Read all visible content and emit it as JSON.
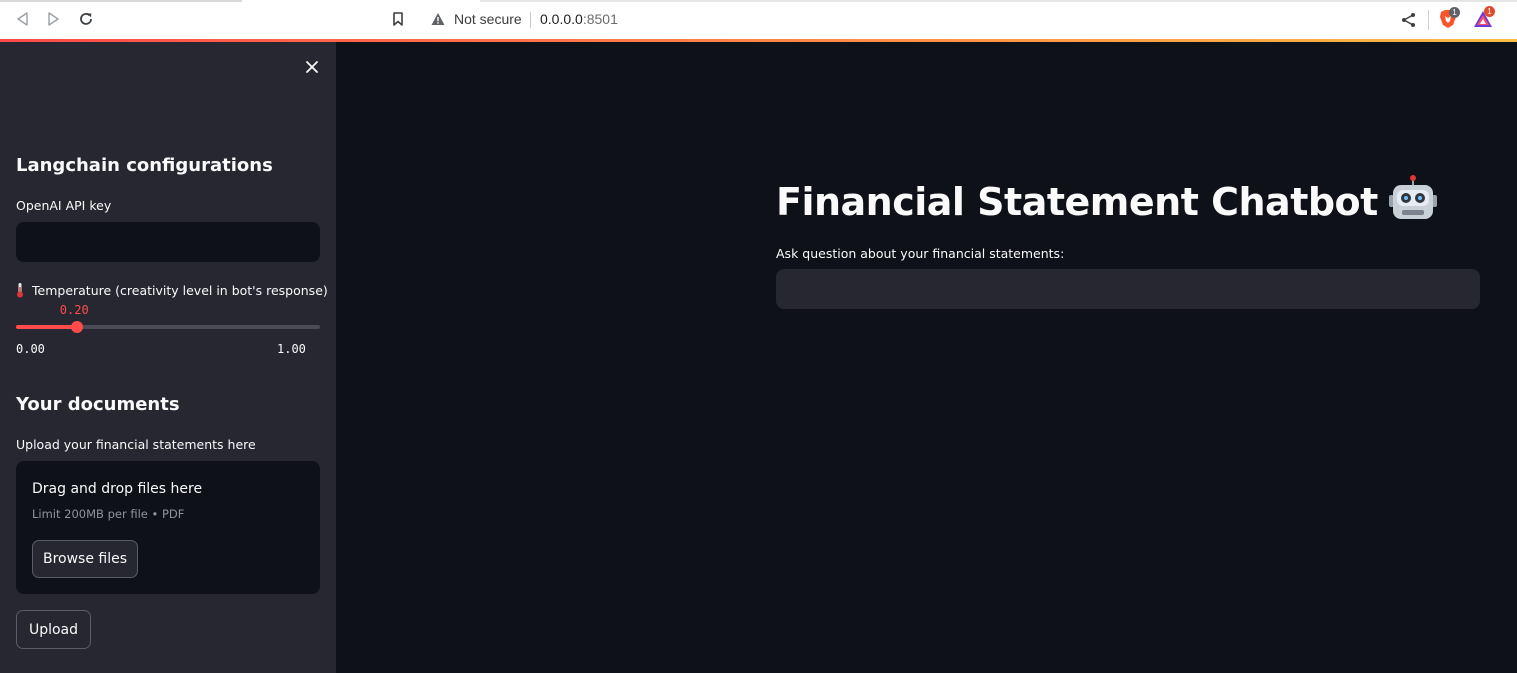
{
  "browser": {
    "security_label": "Not secure",
    "url_host": "0.0.0.0",
    "url_port": ":8501",
    "brave_shield_count": "1",
    "rewards_count": "1"
  },
  "sidebar": {
    "section_title": "Langchain configurations",
    "api_key_label": "OpenAI API key",
    "api_key_value": "",
    "temperature": {
      "label": "Temperature (creativity level in bot's response)",
      "icon": "thermometer-icon",
      "value": 0.2,
      "value_text": "0.20",
      "min": 0.0,
      "max": 1.0,
      "min_text": "0.00",
      "max_text": "1.00"
    },
    "documents_title": "Your documents",
    "upload_label": "Upload your financial statements here",
    "dropzone_title": "Drag and drop files here",
    "dropzone_limit": "Limit 200MB per file • PDF",
    "browse_label": "Browse files",
    "upload_button": "Upload"
  },
  "main": {
    "title": "Financial Statement Chatbot",
    "title_icon": "robot-icon",
    "question_label": "Ask question about your financial statements:",
    "question_value": ""
  },
  "colors": {
    "accent": "#ff4b4b",
    "sidebar_bg": "#262730",
    "main_bg": "#0e1117",
    "text": "#fafafa"
  }
}
